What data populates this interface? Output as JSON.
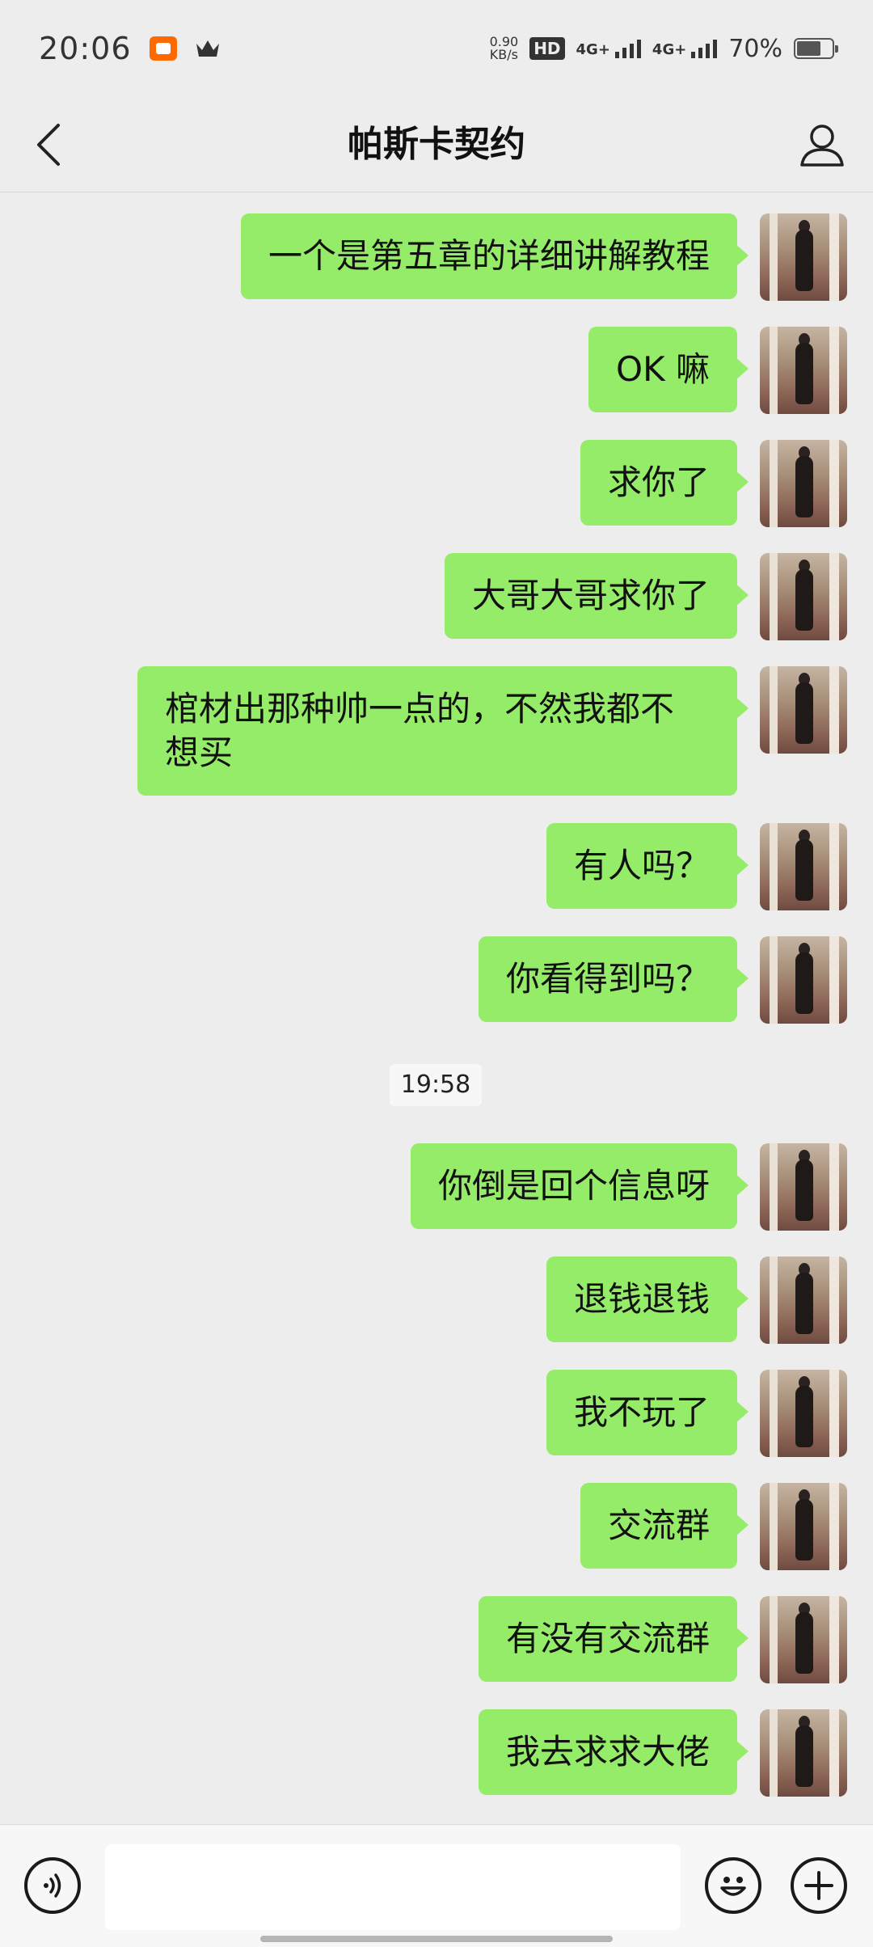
{
  "status_bar": {
    "time": "20:06",
    "net_speed": "0.90",
    "net_unit": "KB/s",
    "hd": "HD",
    "signal1": "4G+",
    "signal2": "4G+",
    "battery": "70%",
    "battery_level": 0.7
  },
  "header": {
    "title": "帕斯卡契约",
    "back_icon": "chevron-left-icon",
    "profile_icon": "person-icon"
  },
  "messages": [
    {
      "text": "一个是第五章的详细讲解教程"
    },
    {
      "text": "OK 嘛"
    },
    {
      "text": "求你了"
    },
    {
      "text": "大哥大哥求你了"
    },
    {
      "text": "棺材出那种帅一点的，不然我都不\n想买"
    },
    {
      "text": "有人吗？"
    },
    {
      "text": "你看得到吗？"
    },
    {
      "text": "你倒是回个信息呀"
    },
    {
      "text": "退钱退钱"
    },
    {
      "text": "我不玩了"
    },
    {
      "text": "交流群"
    },
    {
      "text": "有没有交流群"
    },
    {
      "text": "我去求求大佬"
    }
  ],
  "time_separator": "19:58",
  "input_bar": {
    "voice_icon": "voice-icon",
    "emoji_icon": "emoji-icon",
    "plus_icon": "plus-icon",
    "placeholder": ""
  },
  "colors": {
    "bubble": "#95ec69",
    "background": "#ededed"
  }
}
